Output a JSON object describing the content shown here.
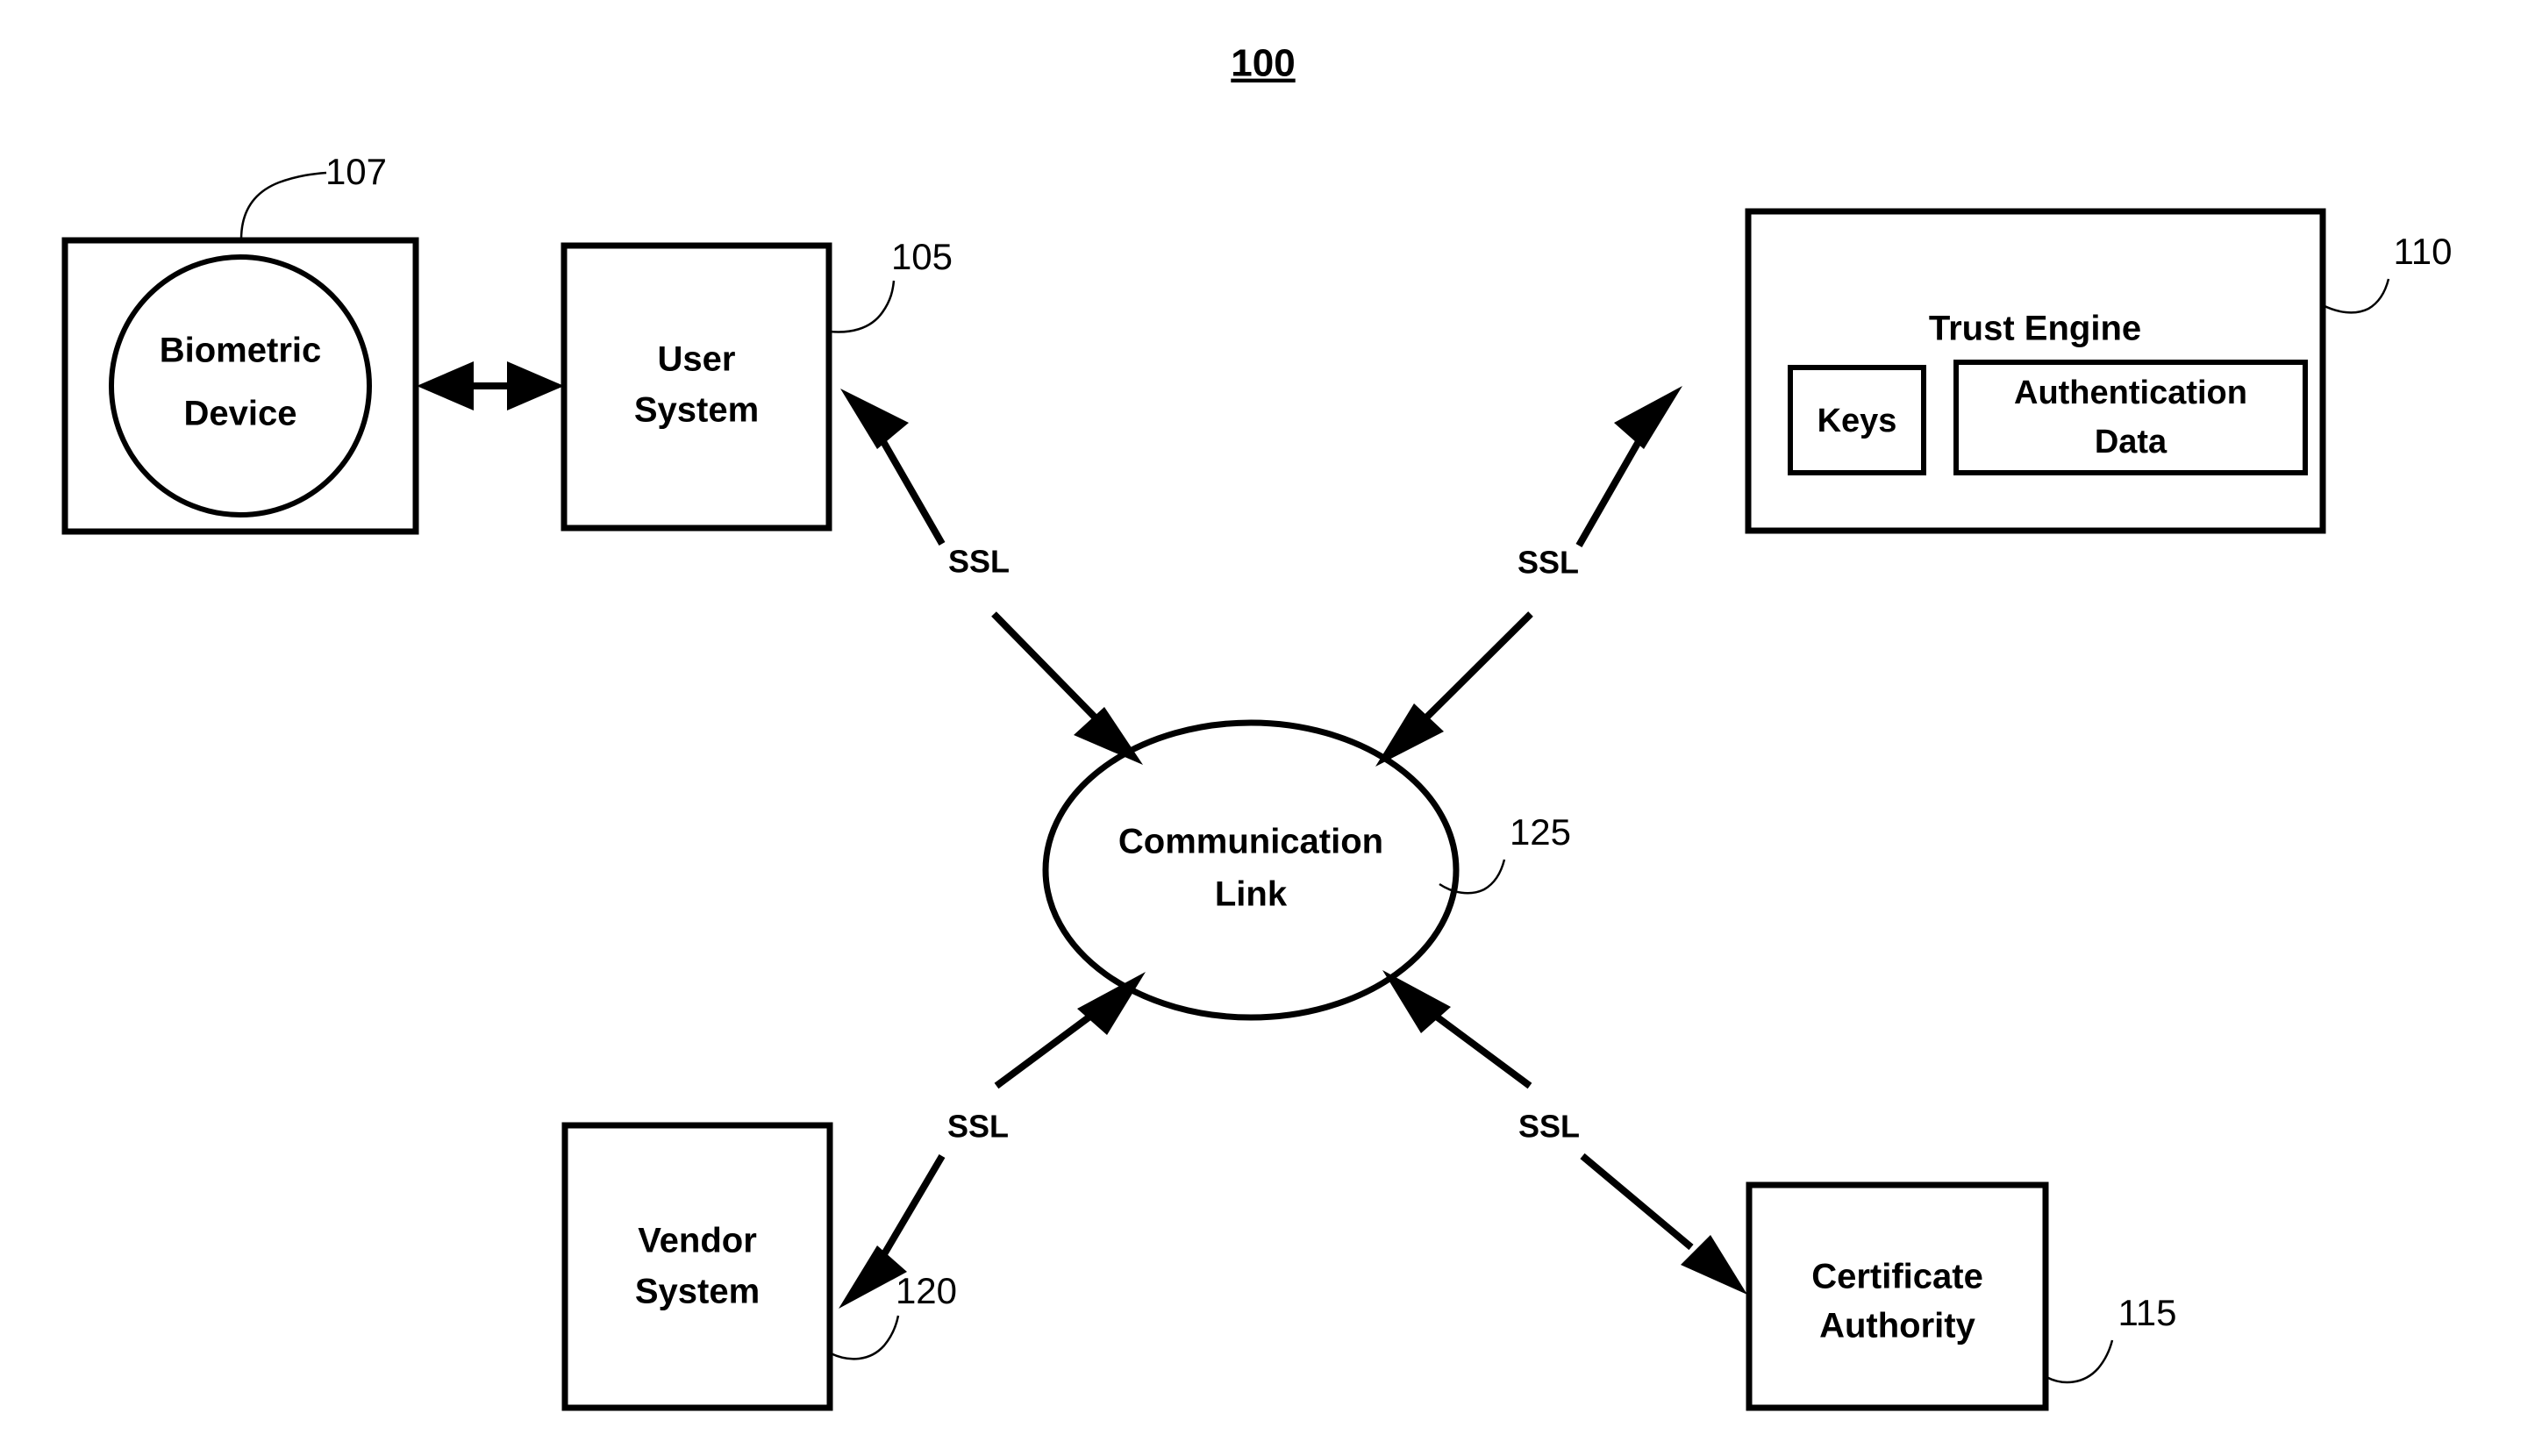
{
  "figure": {
    "number": "100",
    "underlined": true
  },
  "nodes": {
    "biometric_device": {
      "label_line1": "Biometric",
      "label_line2": "Device",
      "ref": "107",
      "shape": "rect-with-circle"
    },
    "user_system": {
      "label_line1": "User",
      "label_line2": "System",
      "ref": "105",
      "shape": "rect"
    },
    "trust_engine": {
      "label": "Trust Engine",
      "ref": "110",
      "shape": "rect",
      "children": {
        "keys": {
          "label": "Keys",
          "shape": "rect"
        },
        "auth_data": {
          "label_line1": "Authentication",
          "label_line2": "Data",
          "shape": "rect"
        }
      }
    },
    "communication_link": {
      "label_line1": "Communication",
      "label_line2": "Link",
      "ref": "125",
      "shape": "ellipse"
    },
    "vendor_system": {
      "label_line1": "Vendor",
      "label_line2": "System",
      "ref": "120",
      "shape": "rect"
    },
    "certificate_authority": {
      "label_line1": "Certificate",
      "label_line2": "Authority",
      "ref": "115",
      "shape": "rect"
    }
  },
  "connections": [
    {
      "id": "biometric-user",
      "label": "",
      "from": "biometric_device",
      "to": "user_system",
      "arrows": "both"
    },
    {
      "id": "user-comm",
      "label": "SSL",
      "from": "user_system",
      "to": "communication_link",
      "arrows": "both"
    },
    {
      "id": "trust-comm",
      "label": "SSL",
      "from": "trust_engine",
      "to": "communication_link",
      "arrows": "both"
    },
    {
      "id": "vendor-comm",
      "label": "SSL",
      "from": "vendor_system",
      "to": "communication_link",
      "arrows": "both"
    },
    {
      "id": "ca-comm",
      "label": "SSL",
      "from": "certificate_authority",
      "to": "communication_link",
      "arrows": "both"
    }
  ],
  "colors": {
    "stroke": "#000000",
    "background": "#ffffff"
  }
}
